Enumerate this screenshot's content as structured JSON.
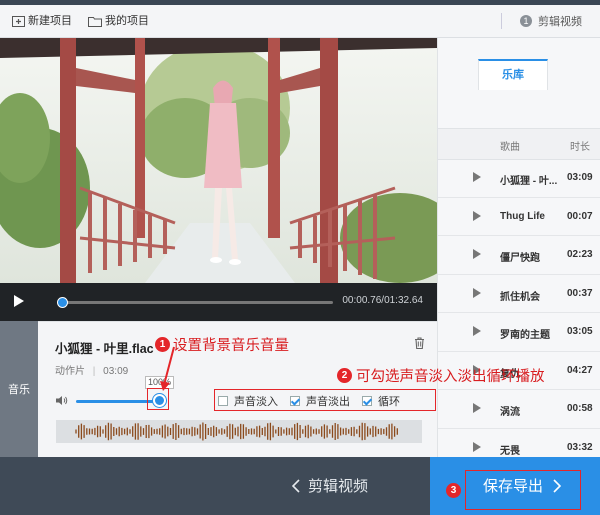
{
  "toolbar": {
    "new_project": "新建项目",
    "my_projects": "我的项目",
    "step_number": "1",
    "step_label": "剪辑视频"
  },
  "player": {
    "time": "00:00.76/01:32.64",
    "progress": 0.008
  },
  "music_panel": {
    "sidebar_label": "音乐",
    "song_title": "小狐狸 - 叶里.flac",
    "type_label": "动作片",
    "duration": "03:09",
    "volume_percent": "100%",
    "fade_in_label": "声音淡入",
    "fade_in_checked": false,
    "fade_out_label": "声音淡出",
    "fade_out_checked": true,
    "loop_label": "循环",
    "loop_checked": true
  },
  "library": {
    "tab_label": "乐库",
    "col_song": "歌曲",
    "col_duration": "时长",
    "songs": [
      {
        "name": "小狐狸 - 叶...",
        "duration": "03:09"
      },
      {
        "name": "Thug Life",
        "duration": "00:07"
      },
      {
        "name": "僵尸快跑",
        "duration": "02:23"
      },
      {
        "name": "抓住机会",
        "duration": "00:37"
      },
      {
        "name": "罗南的主题",
        "duration": "03:05"
      },
      {
        "name": "复仇",
        "duration": "04:27"
      },
      {
        "name": "涡流",
        "duration": "00:58"
      },
      {
        "name": "无畏",
        "duration": "03:32"
      }
    ]
  },
  "footer": {
    "back_label": "剪辑视频",
    "save_label": "保存导出"
  },
  "annotations": {
    "a1_num": "1",
    "a1_text": "设置背景音乐音量",
    "a2_num": "2",
    "a2_text": "可勾选声音淡入淡出循环播放",
    "a3_num": "3"
  },
  "colors": {
    "accent": "#2a8fe6",
    "annotation_red": "#e4262a",
    "footer_bg": "#3f4a57"
  }
}
